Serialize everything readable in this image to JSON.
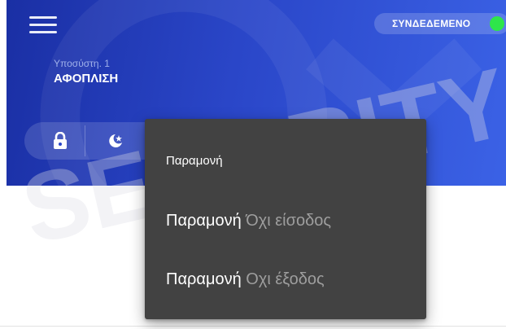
{
  "header": {
    "status_label": "ΣΥΝΔΕΔΕΜΕΝΟ",
    "status_color": "#2ee54a",
    "partition_name": "Υποσύστη. 1",
    "partition_state": "ΑΦΟΠΛΙΣΗ",
    "colors": {
      "gradient_start": "#1a2fa4",
      "gradient_end": "#3b62e6"
    }
  },
  "mode_buttons": [
    {
      "icon": "lock-icon"
    },
    {
      "icon": "moon-star-icon"
    }
  ],
  "popup": {
    "title": "Παραμονή",
    "items": [
      {
        "main": "Παραμονή",
        "sub": "Όχι είσοδος"
      },
      {
        "main": "Παραμονή",
        "sub": "Οχι έξοδος"
      }
    ],
    "background": "#424242"
  },
  "watermark": {
    "text": "SECURITY"
  }
}
